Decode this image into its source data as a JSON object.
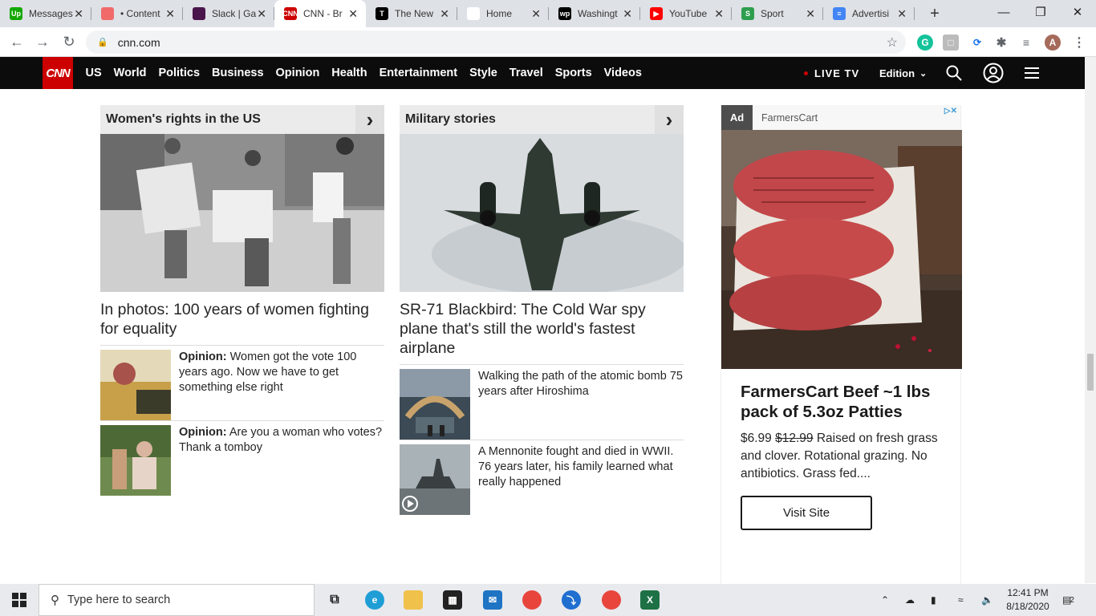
{
  "browser": {
    "tabs": [
      {
        "title": "Messages",
        "favicon_color": "#14a800",
        "favicon_text": "Up",
        "active": false
      },
      {
        "title": "• Content",
        "favicon_color": "#f06a6a",
        "favicon_text": "",
        "active": false
      },
      {
        "title": "Slack | Ga",
        "favicon_color": "#4a154b",
        "favicon_text": "",
        "active": false
      },
      {
        "title": "CNN - Br",
        "favicon_color": "#cc0000",
        "favicon_text": "CNN",
        "active": true
      },
      {
        "title": "The New",
        "favicon_color": "#000000",
        "favicon_text": "T",
        "active": false
      },
      {
        "title": "Home",
        "favicon_color": "#ffffff",
        "favicon_text": "",
        "active": false
      },
      {
        "title": "Washingt",
        "favicon_color": "#000000",
        "favicon_text": "wp",
        "active": false
      },
      {
        "title": "YouTube",
        "favicon_color": "#ff0000",
        "favicon_text": "▶",
        "active": false
      },
      {
        "title": "Sport",
        "favicon_color": "#2e9e4f",
        "favicon_text": "S",
        "active": false
      },
      {
        "title": "Advertisi",
        "favicon_color": "#4285f4",
        "favicon_text": "≡",
        "active": false
      }
    ],
    "url": "cnn.com",
    "profile_initial": "A"
  },
  "cnn_nav": {
    "links": [
      "US",
      "World",
      "Politics",
      "Business",
      "Opinion",
      "Health",
      "Entertainment",
      "Style",
      "Travel",
      "Sports",
      "Videos"
    ],
    "live_tv": "LIVE TV",
    "edition": "Edition"
  },
  "columns": [
    {
      "header": "Women's rights in the US",
      "headline": "In photos: 100 years of women fighting for equality",
      "stories": [
        {
          "label": "Opinion:",
          "text": " Women got the vote 100 years ago. Now we have to get something else right"
        },
        {
          "label": "Opinion:",
          "text": " Are you a woman who votes? Thank a tomboy"
        }
      ]
    },
    {
      "header": "Military stories",
      "headline": "SR-71 Blackbird: The Cold War spy plane that's still the world's fastest airplane",
      "stories": [
        {
          "label": "",
          "text": "Walking the path of the atomic bomb 75 years after Hiroshima"
        },
        {
          "label": "",
          "text": "A Mennonite fought and died in WWII. 76 years later, his family learned what really happened"
        }
      ]
    }
  ],
  "ad": {
    "label": "Ad",
    "source": "FarmersCart",
    "title": "FarmersCart Beef ~1 lbs pack of 5.3oz Patties",
    "price": "$6.99",
    "old_price": "$12.99",
    "body": " Raised on fresh grass and clover. Rotational grazing. No antibiotics. Grass fed....",
    "button": "Visit Site"
  },
  "taskbar": {
    "search_placeholder": "Type here to search",
    "time": "12:41 PM",
    "date": "8/18/2020",
    "notifications": "2"
  }
}
